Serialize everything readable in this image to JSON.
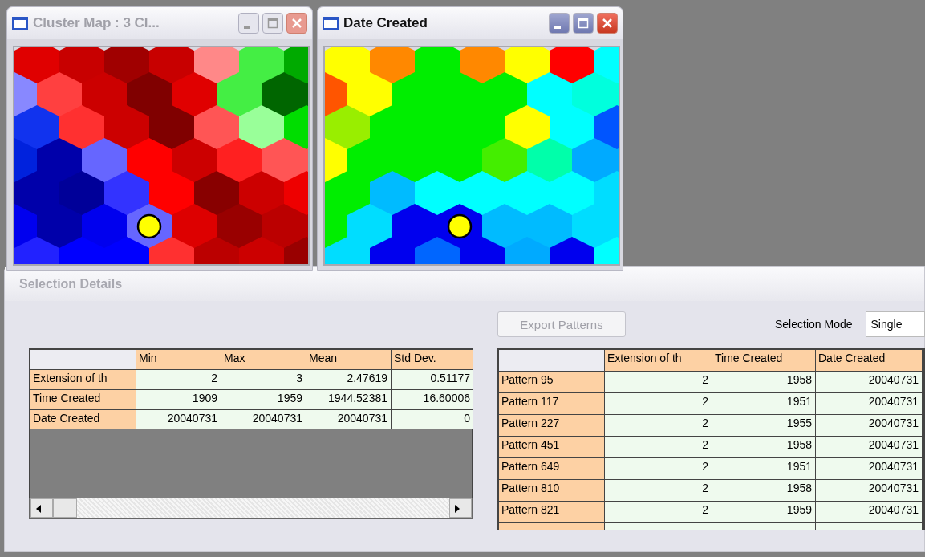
{
  "windows": [
    {
      "title": "Cluster Map : 3 Cl...",
      "active": false
    },
    {
      "title": "Date Created",
      "active": true
    }
  ],
  "selection_details": {
    "title": "Selection Details",
    "export_button": {
      "label": "Export Patterns",
      "disabled": true
    },
    "selection_mode": {
      "label": "Selection Mode",
      "value": "Single"
    },
    "stats_table": {
      "columns": [
        "Min",
        "Max",
        "Mean",
        "Std Dev."
      ],
      "rows": [
        {
          "label": "Extension of th",
          "cells": [
            "2",
            "3",
            "2.47619",
            "0.51177"
          ]
        },
        {
          "label": "Time Created",
          "cells": [
            "1909",
            "1959",
            "1944.52381",
            "16.60006"
          ]
        },
        {
          "label": "Date Created",
          "cells": [
            "20040731",
            "20040731",
            "20040731",
            "0"
          ]
        }
      ]
    },
    "patterns_table": {
      "columns": [
        "Extension of th",
        "Time Created",
        "Date Created"
      ],
      "rows": [
        {
          "label": "Pattern 95",
          "cells": [
            "2",
            "1958",
            "20040731"
          ]
        },
        {
          "label": "Pattern 117",
          "cells": [
            "2",
            "1951",
            "20040731"
          ]
        },
        {
          "label": "Pattern 227",
          "cells": [
            "2",
            "1955",
            "20040731"
          ]
        },
        {
          "label": "Pattern 451",
          "cells": [
            "2",
            "1958",
            "20040731"
          ]
        },
        {
          "label": "Pattern 649",
          "cells": [
            "2",
            "1951",
            "20040731"
          ]
        },
        {
          "label": "Pattern 810",
          "cells": [
            "2",
            "1958",
            "20040731"
          ]
        },
        {
          "label": "Pattern 821",
          "cells": [
            "2",
            "1959",
            "20040731"
          ]
        }
      ]
    }
  }
}
